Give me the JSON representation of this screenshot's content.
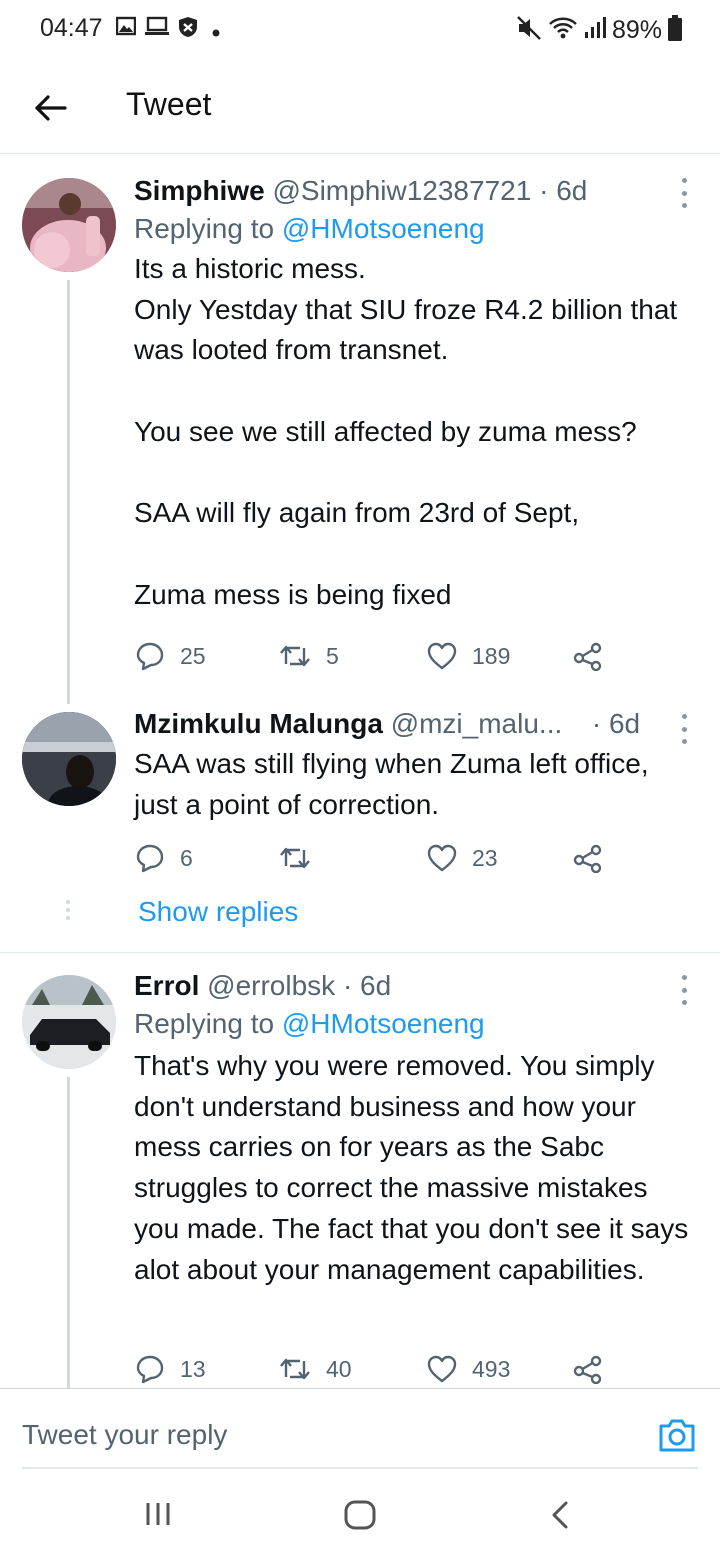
{
  "status_bar": {
    "time": "04:47",
    "battery": "89%",
    "icons": [
      "gallery-icon",
      "laptop-icon",
      "shield-icon",
      "dot-icon",
      "mute-icon",
      "wifi-icon",
      "signal-icon",
      "battery-icon"
    ]
  },
  "header": {
    "back_icon": "arrow-left-icon",
    "title": "Tweet"
  },
  "tweets": [
    {
      "name": "Simphiwe",
      "handle": "@Simphiw12387721",
      "dot": "·",
      "time": "6d",
      "replying_label": "Replying to",
      "replying_to": "@HMotsoeneng",
      "text": "Its a historic mess.\nOnly Yestday that SIU froze R4.2 billion that was looted from transnet.\n\nYou see we still affected by zuma mess?\n\nSAA will fly again from 23rd of Sept,\n\nZuma mess is being fixed",
      "replies": "25",
      "retweets": "5",
      "likes": "189"
    },
    {
      "name": "Mzimkulu Malunga",
      "handle": "@mzi_malu...",
      "dot": "·",
      "time": "6d",
      "text": "SAA was still flying when Zuma left office, just a point of correction.",
      "replies": "6",
      "retweets": "",
      "likes": "23",
      "show_replies": "Show replies"
    },
    {
      "name": "Errol",
      "handle": "@errolbsk",
      "dot": "·",
      "time": "6d",
      "replying_label": "Replying to",
      "replying_to": "@HMotsoeneng",
      "text": "That's why you were removed. You simply don't understand business and how your mess carries on for years as the Sabc struggles to correct the massive mistakes you made. The fact that you don't see it says alot about your management capabilities.",
      "replies": "13",
      "retweets": "40",
      "likes": "493"
    }
  ],
  "reply_bar": {
    "placeholder": "Tweet your reply",
    "camera_icon": "camera-icon"
  },
  "nav_bar": {
    "icons": [
      "recents-icon",
      "home-icon",
      "back-nav-icon"
    ]
  },
  "colors": {
    "accent": "#1d9bf0",
    "secondary_text": "#536471",
    "primary_text": "#0f1419",
    "divider": "#e1e8ed"
  }
}
